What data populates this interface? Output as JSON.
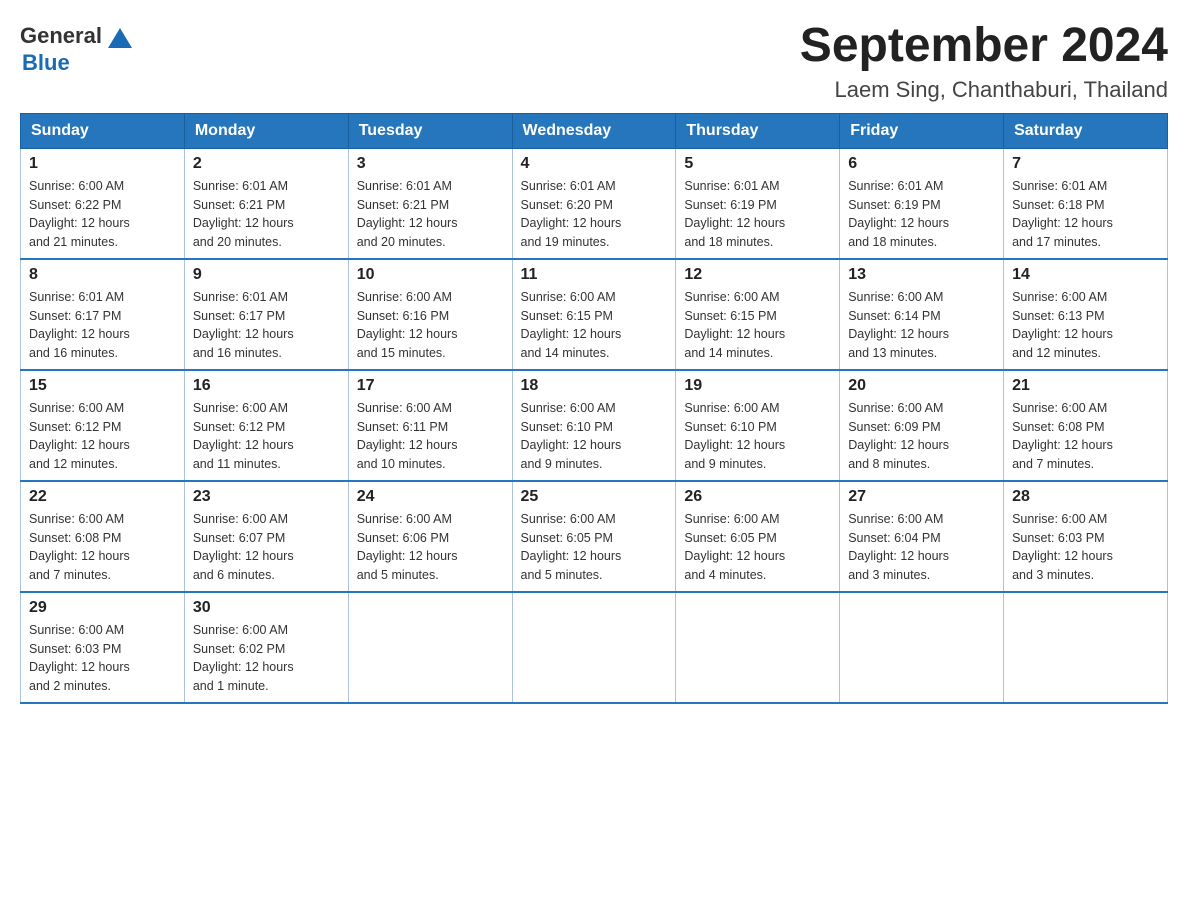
{
  "header": {
    "logo_general": "General",
    "logo_blue": "Blue",
    "title": "September 2024",
    "subtitle": "Laem Sing, Chanthaburi, Thailand"
  },
  "weekdays": [
    "Sunday",
    "Monday",
    "Tuesday",
    "Wednesday",
    "Thursday",
    "Friday",
    "Saturday"
  ],
  "weeks": [
    [
      {
        "day": "1",
        "sunrise": "6:00 AM",
        "sunset": "6:22 PM",
        "daylight": "12 hours and 21 minutes."
      },
      {
        "day": "2",
        "sunrise": "6:01 AM",
        "sunset": "6:21 PM",
        "daylight": "12 hours and 20 minutes."
      },
      {
        "day": "3",
        "sunrise": "6:01 AM",
        "sunset": "6:21 PM",
        "daylight": "12 hours and 20 minutes."
      },
      {
        "day": "4",
        "sunrise": "6:01 AM",
        "sunset": "6:20 PM",
        "daylight": "12 hours and 19 minutes."
      },
      {
        "day": "5",
        "sunrise": "6:01 AM",
        "sunset": "6:19 PM",
        "daylight": "12 hours and 18 minutes."
      },
      {
        "day": "6",
        "sunrise": "6:01 AM",
        "sunset": "6:19 PM",
        "daylight": "12 hours and 18 minutes."
      },
      {
        "day": "7",
        "sunrise": "6:01 AM",
        "sunset": "6:18 PM",
        "daylight": "12 hours and 17 minutes."
      }
    ],
    [
      {
        "day": "8",
        "sunrise": "6:01 AM",
        "sunset": "6:17 PM",
        "daylight": "12 hours and 16 minutes."
      },
      {
        "day": "9",
        "sunrise": "6:01 AM",
        "sunset": "6:17 PM",
        "daylight": "12 hours and 16 minutes."
      },
      {
        "day": "10",
        "sunrise": "6:00 AM",
        "sunset": "6:16 PM",
        "daylight": "12 hours and 15 minutes."
      },
      {
        "day": "11",
        "sunrise": "6:00 AM",
        "sunset": "6:15 PM",
        "daylight": "12 hours and 14 minutes."
      },
      {
        "day": "12",
        "sunrise": "6:00 AM",
        "sunset": "6:15 PM",
        "daylight": "12 hours and 14 minutes."
      },
      {
        "day": "13",
        "sunrise": "6:00 AM",
        "sunset": "6:14 PM",
        "daylight": "12 hours and 13 minutes."
      },
      {
        "day": "14",
        "sunrise": "6:00 AM",
        "sunset": "6:13 PM",
        "daylight": "12 hours and 12 minutes."
      }
    ],
    [
      {
        "day": "15",
        "sunrise": "6:00 AM",
        "sunset": "6:12 PM",
        "daylight": "12 hours and 12 minutes."
      },
      {
        "day": "16",
        "sunrise": "6:00 AM",
        "sunset": "6:12 PM",
        "daylight": "12 hours and 11 minutes."
      },
      {
        "day": "17",
        "sunrise": "6:00 AM",
        "sunset": "6:11 PM",
        "daylight": "12 hours and 10 minutes."
      },
      {
        "day": "18",
        "sunrise": "6:00 AM",
        "sunset": "6:10 PM",
        "daylight": "12 hours and 9 minutes."
      },
      {
        "day": "19",
        "sunrise": "6:00 AM",
        "sunset": "6:10 PM",
        "daylight": "12 hours and 9 minutes."
      },
      {
        "day": "20",
        "sunrise": "6:00 AM",
        "sunset": "6:09 PM",
        "daylight": "12 hours and 8 minutes."
      },
      {
        "day": "21",
        "sunrise": "6:00 AM",
        "sunset": "6:08 PM",
        "daylight": "12 hours and 7 minutes."
      }
    ],
    [
      {
        "day": "22",
        "sunrise": "6:00 AM",
        "sunset": "6:08 PM",
        "daylight": "12 hours and 7 minutes."
      },
      {
        "day": "23",
        "sunrise": "6:00 AM",
        "sunset": "6:07 PM",
        "daylight": "12 hours and 6 minutes."
      },
      {
        "day": "24",
        "sunrise": "6:00 AM",
        "sunset": "6:06 PM",
        "daylight": "12 hours and 5 minutes."
      },
      {
        "day": "25",
        "sunrise": "6:00 AM",
        "sunset": "6:05 PM",
        "daylight": "12 hours and 5 minutes."
      },
      {
        "day": "26",
        "sunrise": "6:00 AM",
        "sunset": "6:05 PM",
        "daylight": "12 hours and 4 minutes."
      },
      {
        "day": "27",
        "sunrise": "6:00 AM",
        "sunset": "6:04 PM",
        "daylight": "12 hours and 3 minutes."
      },
      {
        "day": "28",
        "sunrise": "6:00 AM",
        "sunset": "6:03 PM",
        "daylight": "12 hours and 3 minutes."
      }
    ],
    [
      {
        "day": "29",
        "sunrise": "6:00 AM",
        "sunset": "6:03 PM",
        "daylight": "12 hours and 2 minutes."
      },
      {
        "day": "30",
        "sunrise": "6:00 AM",
        "sunset": "6:02 PM",
        "daylight": "12 hours and 1 minute."
      },
      null,
      null,
      null,
      null,
      null
    ]
  ],
  "labels": {
    "sunrise": "Sunrise:",
    "sunset": "Sunset:",
    "daylight": "Daylight:"
  }
}
